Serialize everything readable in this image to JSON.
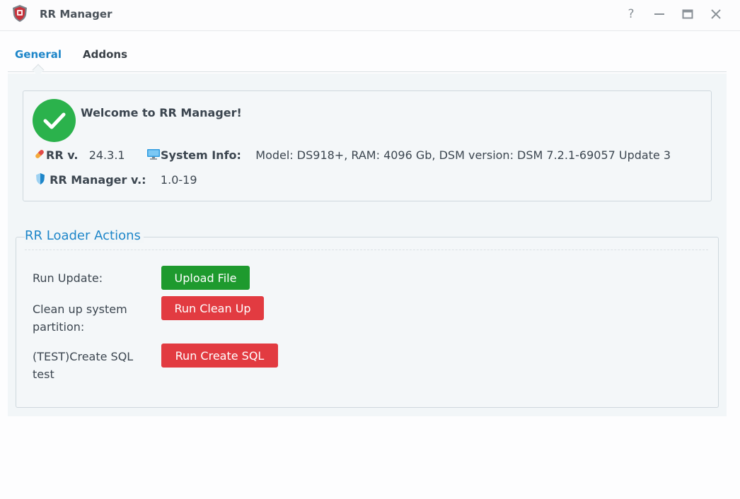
{
  "window": {
    "title": "RR Manager",
    "icon": "shield-logo-icon",
    "controls": [
      "help-icon",
      "minimize-icon",
      "maximize-icon",
      "close-icon"
    ],
    "help_label": "?"
  },
  "tabs": [
    {
      "label": "General",
      "active": true
    },
    {
      "label": "Addons",
      "active": false
    }
  ],
  "welcome": {
    "title": "Welcome to RR Manager!",
    "rr_version_label": "RR v.",
    "rr_version_value": "24.3.1",
    "system_info_label": "System Info:",
    "system_info_value": "Model: DS918+, RAM: 4096 Gb, DSM version: DSM 7.2.1-69057 Update 3",
    "manager_version_label": "RR Manager v.:",
    "manager_version_value": "1.0-19"
  },
  "actions": {
    "legend": "RR Loader Actions",
    "rows": [
      {
        "label": "Run Update:",
        "button": "Upload File",
        "color": "#1e9a2e"
      },
      {
        "label": "Clean up system partition:",
        "button": "Run Clean Up",
        "color": "#e23b41"
      },
      {
        "label": "(TEST)Create SQL test",
        "button": "Run Create SQL",
        "color": "#e23b41"
      }
    ]
  },
  "colors": {
    "accent": "#1e86c9",
    "success": "#2bb24c",
    "danger": "#e23b41",
    "primary_button": "#1e9a2e"
  }
}
